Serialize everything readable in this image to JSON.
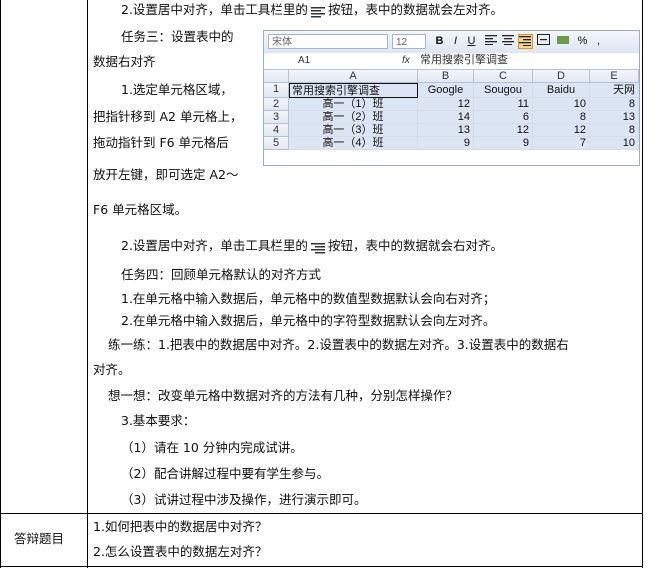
{
  "lines": {
    "l1": "2.设置居中对齐，单击工具栏里的",
    "l1b": "按钮，表中的数据就会左对齐。",
    "task3_title": "任务三：设置表中的",
    "task3_title2": "数据右对齐",
    "step1_a": "1.选定单元格区域，",
    "step1_b": "把指针移到 A2 单元格上，",
    "step1_c": "拖动指针到 F6 单元格后",
    "step1_d": "放开左键，即可选定 A2～",
    "step1_e": "F6 单元格区域。",
    "step2_a": "2.设置居中对齐，单击工具栏里的",
    "step2_b": "按钮，表中的数据就会右对齐。",
    "task4": "任务四：回顾单元格默认的对齐方式",
    "task4_1": "1.在单元格中输入数据后，单元格中的数值型数据默认会向右对齐；",
    "task4_2": "2.在单元格中输入数据后，单元格中的字符型数据默认会向左对齐。",
    "practice": "练一练：1.把表中的数据居中对齐。2.设置表中的数据左对齐。3.设置表中的数据右",
    "practice2": "对齐。",
    "think": "想一想：改变单元格中数据对齐的方法有几种，分别怎样操作？",
    "req": "3.基本要求：",
    "req1": "（1）请在 10 分钟内完成试讲。",
    "req2": "（2）配合讲解过程中要有学生参与。",
    "req3": "（3）试讲过程中涉及操作，进行演示即可。"
  },
  "defense": {
    "label": "答辩题目",
    "q1": "1.如何把表中的数据居中对齐？",
    "q2": "2.怎么设置表中的数据左对齐？"
  },
  "excel": {
    "font": "宋体",
    "size": "12",
    "cell_ref": "A1",
    "fx": "fx",
    "formula": "常用搜索引擎调查",
    "columns": [
      "A",
      "B",
      "C",
      "D",
      "E"
    ],
    "rows": [
      {
        "n": "1",
        "cells": [
          "常用搜索引擎调查",
          "Google",
          "Sougou",
          "Baidu",
          "天网"
        ]
      },
      {
        "n": "2",
        "cells": [
          "高一（1）班",
          "12",
          "11",
          "10",
          "8"
        ]
      },
      {
        "n": "3",
        "cells": [
          "高一（2）班",
          "14",
          "6",
          "8",
          "13"
        ]
      },
      {
        "n": "4",
        "cells": [
          "高一（3）班",
          "13",
          "12",
          "12",
          "8"
        ]
      },
      {
        "n": "5",
        "cells": [
          "高一（4）班",
          "9",
          "9",
          "7",
          "10"
        ]
      }
    ]
  }
}
